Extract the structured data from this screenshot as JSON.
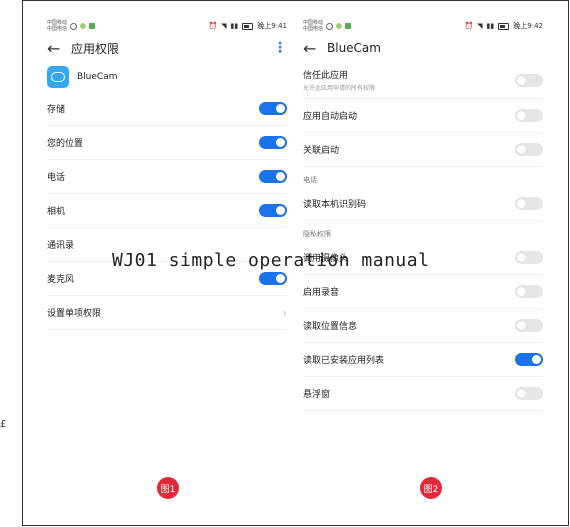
{
  "left_mark": "£",
  "overlay_text": "WJ01 simple operation manual",
  "phone1": {
    "status": {
      "carrier_1": "中国移动",
      "carrier_2": "中国电信",
      "time": "晚上9:41"
    },
    "title": "应用权限",
    "app_name": "BlueCam",
    "rows": [
      {
        "label": "存储",
        "state": "on"
      },
      {
        "label": "您的位置",
        "state": "on"
      },
      {
        "label": "电话",
        "state": "on"
      },
      {
        "label": "相机",
        "state": "on"
      },
      {
        "label": "通讯录",
        "state": "off"
      },
      {
        "label": "麦克风",
        "state": "on"
      },
      {
        "label": "设置单项权限",
        "state": "chevron"
      }
    ],
    "badge": "图1"
  },
  "phone2": {
    "status": {
      "carrier_1": "中国移动",
      "carrier_2": "中国电信",
      "time": "晚上9:42"
    },
    "title": "BlueCam",
    "trust_row": {
      "label": "信任此应用",
      "sub": "允许此应用申请的所有权限"
    },
    "auto_start": "应用自动启动",
    "linked_start": "关联启动",
    "section_phone": "电话",
    "read_id": "读取本机识别码",
    "section_privacy": "隐私权限",
    "camera": "调用摄像头",
    "record": "启用录音",
    "location": "读取位置信息",
    "installed": "读取已安装应用列表",
    "floating": "悬浮窗",
    "badge": "图2"
  },
  "colors": {
    "accent": "#1a73e8",
    "badge": "#e3283a",
    "app_icon": "#35a9f0"
  }
}
